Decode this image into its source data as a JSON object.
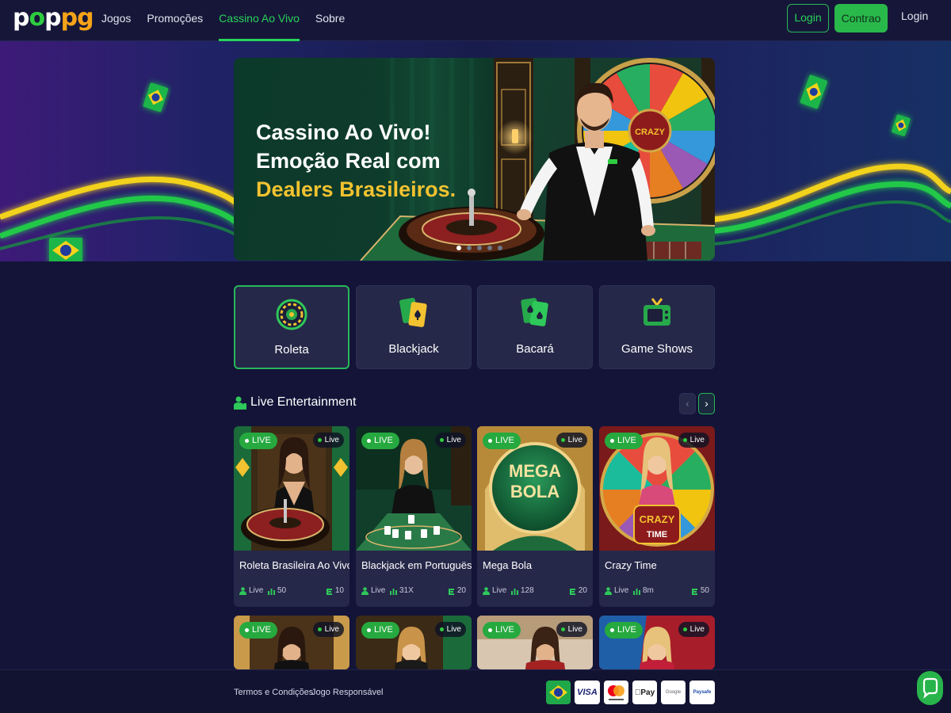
{
  "header": {
    "logo": {
      "pre": "p",
      "mid": "o",
      "post1": "p",
      "post2": "pg"
    },
    "nav": [
      {
        "label": "Jogos",
        "active": false
      },
      {
        "label": "Promoções",
        "active": false
      },
      {
        "label": "Cassino Ao Vivo",
        "active": true
      },
      {
        "label": "Sobre",
        "active": false
      }
    ],
    "login_outline": "Login",
    "register": "Contrao",
    "login_text": "Login"
  },
  "hero": {
    "line1": "Cassino Ao Vivo!",
    "line2": "Emoção Real com",
    "line3": "Dealers Brasileiros.",
    "wheel_text": "CRAZY",
    "active_slide": 0,
    "slides": 5
  },
  "categories": [
    {
      "label": "Roleta",
      "icon": "roulette-icon",
      "active": true
    },
    {
      "label": "Blackjack",
      "icon": "cards-icon",
      "active": false
    },
    {
      "label": "Bacará",
      "icon": "cards-icon",
      "active": false
    },
    {
      "label": "Game Shows",
      "icon": "tv-icon",
      "active": false
    }
  ],
  "section": {
    "title": "Live Entertainment",
    "prev": "‹",
    "next": "›"
  },
  "games": [
    {
      "name": "Roleta Brasileira Ao Vivo",
      "badge": "LIVE",
      "badge2": "Live",
      "status": "Live",
      "players": "50",
      "bets": "10"
    },
    {
      "name": "Blackjack em Portuguës",
      "badge": "LIVE",
      "badge2": "Live",
      "status": "Live",
      "players": "31X",
      "bets": "20"
    },
    {
      "name": "Mega Bola",
      "badge": "LIVE",
      "badge2": "Live",
      "status": "Live",
      "players": "128",
      "bets": "20",
      "thumb_text1": "MEGA",
      "thumb_text2": "BOLA"
    },
    {
      "name": "Crazy Time",
      "badge": "LIVE",
      "badge2": "Live",
      "status": "Live",
      "players": "8m",
      "bets": "50",
      "thumb_text1": "CRAZY",
      "thumb_text2": "TIME"
    }
  ],
  "games_row2": [
    {
      "badge": "LIVE",
      "badge2": "Live"
    },
    {
      "badge": "LIVE",
      "badge2": "Live"
    },
    {
      "badge": "LIVE",
      "badge2": "Live"
    },
    {
      "badge": "LIVE",
      "badge2": "Live"
    }
  ],
  "footer": {
    "terms": "Termos e Condições",
    "responsible": "Jogo Responsável",
    "payments": [
      "VISA",
      "Pay",
      "Google",
      "Paysafe"
    ]
  },
  "colors": {
    "accent": "#27b85a",
    "gold": "#f2c230",
    "bg": "#131438",
    "card": "#262849"
  }
}
